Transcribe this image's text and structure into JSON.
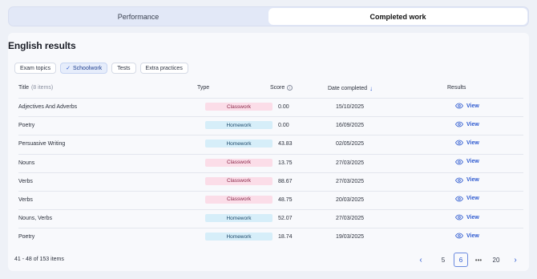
{
  "tabs": [
    {
      "label": "Performance",
      "active": false
    },
    {
      "label": "Completed work",
      "active": true
    }
  ],
  "section_title": "English results",
  "filters": [
    {
      "label": "Exam topics",
      "active": false
    },
    {
      "label": "Schoolwork",
      "active": true
    },
    {
      "label": "Tests",
      "active": false
    },
    {
      "label": "Extra practices",
      "active": false
    }
  ],
  "columns": {
    "title": "Title",
    "title_count": "(8 items)",
    "type": "Type",
    "score": "Score",
    "date": "Date completed",
    "results": "Results"
  },
  "rows": [
    {
      "title": "Adjectives And Adverbs",
      "type": "Classwork",
      "score": "0.00",
      "date": "15/10/2025",
      "action": "View"
    },
    {
      "title": "Poetry",
      "type": "Homework",
      "score": "0.00",
      "date": "16/09/2025",
      "action": "View"
    },
    {
      "title": "Persuasive Writing",
      "type": "Homework",
      "score": "43.83",
      "date": "02/05/2025",
      "action": "View"
    },
    {
      "title": "Nouns",
      "type": "Classwork",
      "score": "13.75",
      "date": "27/03/2025",
      "action": "View"
    },
    {
      "title": "Verbs",
      "type": "Classwork",
      "score": "88.67",
      "date": "27/03/2025",
      "action": "View"
    },
    {
      "title": "Verbs",
      "type": "Classwork",
      "score": "48.75",
      "date": "20/03/2025",
      "action": "View"
    },
    {
      "title": "Nouns, Verbs",
      "type": "Homework",
      "score": "52.07",
      "date": "27/03/2025",
      "action": "View"
    },
    {
      "title": "Poetry",
      "type": "Homework",
      "score": "18.74",
      "date": "19/03/2025",
      "action": "View"
    }
  ],
  "footer": {
    "count": "41 - 48 of 153 items",
    "pages": [
      "5",
      "6",
      "•••",
      "20"
    ],
    "current_page": "6"
  },
  "colors": {
    "accent": "#2f5bd0",
    "classwork_bg": "#fbdde8",
    "homework_bg": "#d6eef9"
  }
}
